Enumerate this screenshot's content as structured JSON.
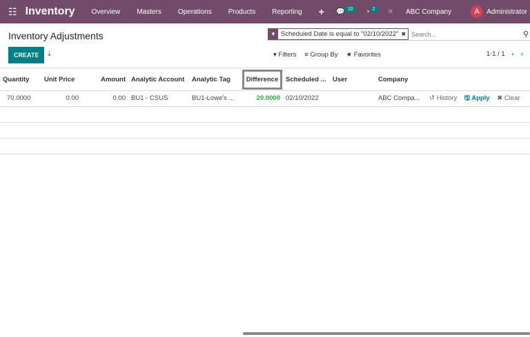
{
  "nav": {
    "app": "Inventory",
    "menus": [
      "Overview",
      "Masters",
      "Operations",
      "Products",
      "Reporting"
    ],
    "plus": "+",
    "messages_count": "10",
    "activities_count": "2",
    "company": "ABC Company",
    "user_initial": "A",
    "user": "Administrator"
  },
  "page": {
    "title": "Inventory Adjustments",
    "create": "CREATE"
  },
  "search": {
    "facet": "Scheduled Date is equal to \"02/10/2022\"",
    "placeholder": "Search..."
  },
  "toolbar": {
    "filters": "Filters",
    "group_by": "Group By",
    "favorites": "Favorites",
    "pager": "1-1 / 1"
  },
  "table": {
    "columns": [
      "Quantity",
      "Unit Price",
      "Amount",
      "Analytic Account",
      "Analytic Tag",
      "Difference",
      "Scheduled ...",
      "User",
      "Company"
    ],
    "rows": [
      {
        "quantity": "70.0000",
        "unit_price": "0.00",
        "amount": "0.00",
        "analytic_account": "BU1 - CSUS",
        "analytic_tag": "BU1-Lowe's ...",
        "difference": "20.0000",
        "scheduled": "02/10/2022",
        "user": "",
        "company": "ABC Compa...",
        "history": "History",
        "apply": "Apply",
        "clear": "Clear"
      }
    ]
  },
  "colors": {
    "brand": "#714b67",
    "accent": "#017e84",
    "positive": "#28a745"
  }
}
